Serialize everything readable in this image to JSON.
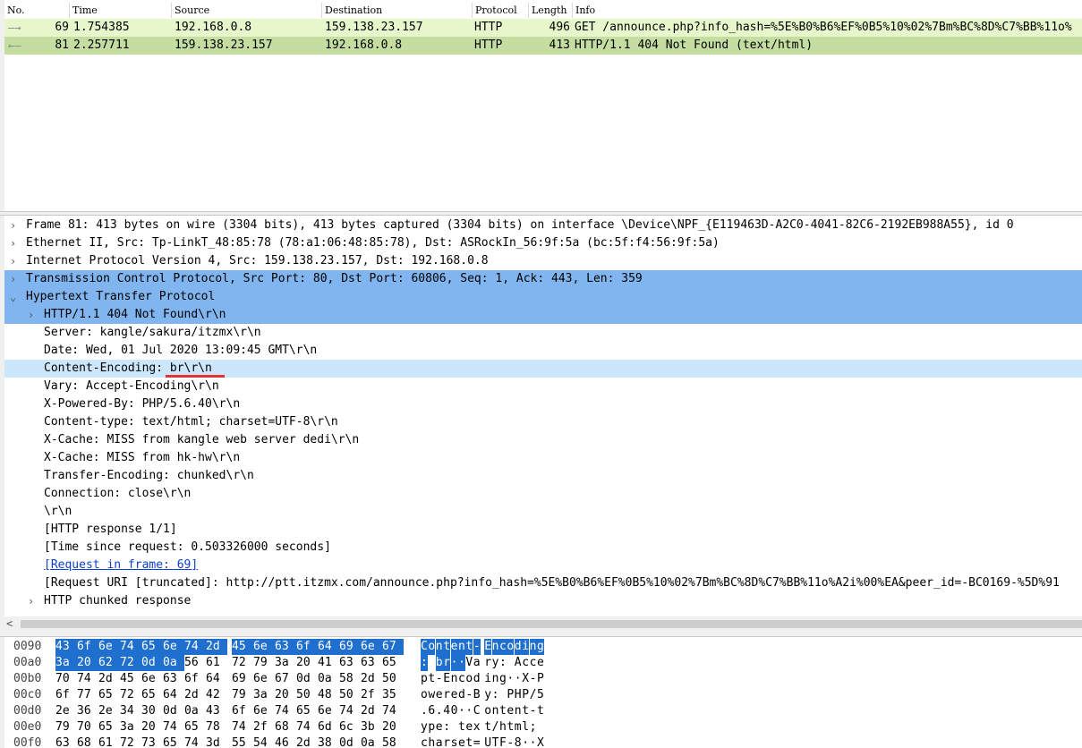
{
  "packet_list": {
    "columns": [
      "No.",
      "Time",
      "Source",
      "Destination",
      "Protocol",
      "Length",
      "Info"
    ],
    "rows": [
      {
        "no": "69",
        "time": "1.754385",
        "source": "192.168.0.8",
        "destination": "159.138.23.157",
        "protocol": "HTTP",
        "length": "496",
        "info": "GET /announce.php?info_hash=%5E%B0%B6%EF%0B5%10%02%7Bm%BC%8D%C7%BB%11o%",
        "direction": "request",
        "bg": "#e6f7cb"
      },
      {
        "no": "81",
        "time": "2.257711",
        "source": "159.138.23.157",
        "destination": "192.168.0.8",
        "protocol": "HTTP",
        "length": "413",
        "info": "HTTP/1.1 404 Not Found  (text/html)",
        "direction": "response",
        "bg": "#c4dea2"
      }
    ]
  },
  "details": {
    "frame": "Frame 81: 413 bytes on wire (3304 bits), 413 bytes captured (3304 bits) on interface \\Device\\NPF_{E119463D-A2C0-4041-82C6-2192EB988A55}, id 0",
    "ethernet": "Ethernet II, Src: Tp-LinkT_48:85:78 (78:a1:06:48:85:78), Dst: ASRockIn_56:9f:5a (bc:5f:f4:56:9f:5a)",
    "ip": "Internet Protocol Version 4, Src: 159.138.23.157, Dst: 192.168.0.8",
    "tcp": "Transmission Control Protocol, Src Port: 80, Dst Port: 60806, Seq: 1, Ack: 443, Len: 359",
    "http": "Hypertext Transfer Protocol",
    "http_fields": {
      "status_line": "HTTP/1.1 404 Not Found\\r\\n",
      "server": "Server: kangle/sakura/itzmx\\r\\n",
      "date": "Date: Wed, 01 Jul 2020 13:09:45 GMT\\r\\n",
      "content_encoding": "Content-Encoding: br\\r\\n",
      "vary": "Vary: Accept-Encoding\\r\\n",
      "x_powered_by": "X-Powered-By: PHP/5.6.40\\r\\n",
      "content_type": "Content-type: text/html; charset=UTF-8\\r\\n",
      "x_cache": "X-Cache: MISS from kangle web server dedi\\r\\n",
      "x_cache_hw": "X-Cache: MISS from hk-hw\\r\\n",
      "transfer_encoding": "Transfer-Encoding: chunked\\r\\n",
      "connection": "Connection: close\\r\\n",
      "crlf": "\\r\\n",
      "response_num": "[HTTP response 1/1]",
      "time_since": "[Time since request: 0.503326000 seconds]",
      "request_in_frame": "[Request in frame: 69]",
      "request_uri": "[Request URI [truncated]: http://ptt.itzmx.com/announce.php?info_hash=%5E%B0%B6%EF%0B5%10%02%7Bm%BC%8D%C7%BB%11o%A2i%00%EA&peer_id=-BC0169-%5D%91",
      "chunked": "HTTP chunked response"
    }
  },
  "bytes": [
    {
      "offset": "0090",
      "hex": [
        "43",
        "6f",
        "6e",
        "74",
        "65",
        "6e",
        "74",
        "2d",
        "45",
        "6e",
        "63",
        "6f",
        "64",
        "69",
        "6e",
        "67"
      ],
      "ascii": "Content-Encoding",
      "sel_count": 16
    },
    {
      "offset": "00a0",
      "hex": [
        "3a",
        "20",
        "62",
        "72",
        "0d",
        "0a",
        "56",
        "61",
        "72",
        "79",
        "3a",
        "20",
        "41",
        "63",
        "63",
        "65"
      ],
      "ascii": ": br··Vary: Acce",
      "sel_count": 6
    },
    {
      "offset": "00b0",
      "hex": [
        "70",
        "74",
        "2d",
        "45",
        "6e",
        "63",
        "6f",
        "64",
        "69",
        "6e",
        "67",
        "0d",
        "0a",
        "58",
        "2d",
        "50"
      ],
      "ascii": "pt-Encoding··X-P",
      "sel_count": 0
    },
    {
      "offset": "00c0",
      "hex": [
        "6f",
        "77",
        "65",
        "72",
        "65",
        "64",
        "2d",
        "42",
        "79",
        "3a",
        "20",
        "50",
        "48",
        "50",
        "2f",
        "35"
      ],
      "ascii": "owered-By: PHP/5",
      "sel_count": 0
    },
    {
      "offset": "00d0",
      "hex": [
        "2e",
        "36",
        "2e",
        "34",
        "30",
        "0d",
        "0a",
        "43",
        "6f",
        "6e",
        "74",
        "65",
        "6e",
        "74",
        "2d",
        "74"
      ],
      "ascii": ".6.40··Content-t",
      "sel_count": 0
    },
    {
      "offset": "00e0",
      "hex": [
        "79",
        "70",
        "65",
        "3a",
        "20",
        "74",
        "65",
        "78",
        "74",
        "2f",
        "68",
        "74",
        "6d",
        "6c",
        "3b",
        "20"
      ],
      "ascii": "ype: text/html; ",
      "sel_count": 0
    },
    {
      "offset": "00f0",
      "hex": [
        "63",
        "68",
        "61",
        "72",
        "73",
        "65",
        "74",
        "3d",
        "55",
        "54",
        "46",
        "2d",
        "38",
        "0d",
        "0a",
        "58"
      ],
      "ascii": "charset=UTF-8··X",
      "sel_count": 0
    }
  ],
  "icons": {
    "expand": "chevron-right-icon",
    "collapse": "chevron-down-icon",
    "scroll_left": "scroll-left-icon"
  }
}
